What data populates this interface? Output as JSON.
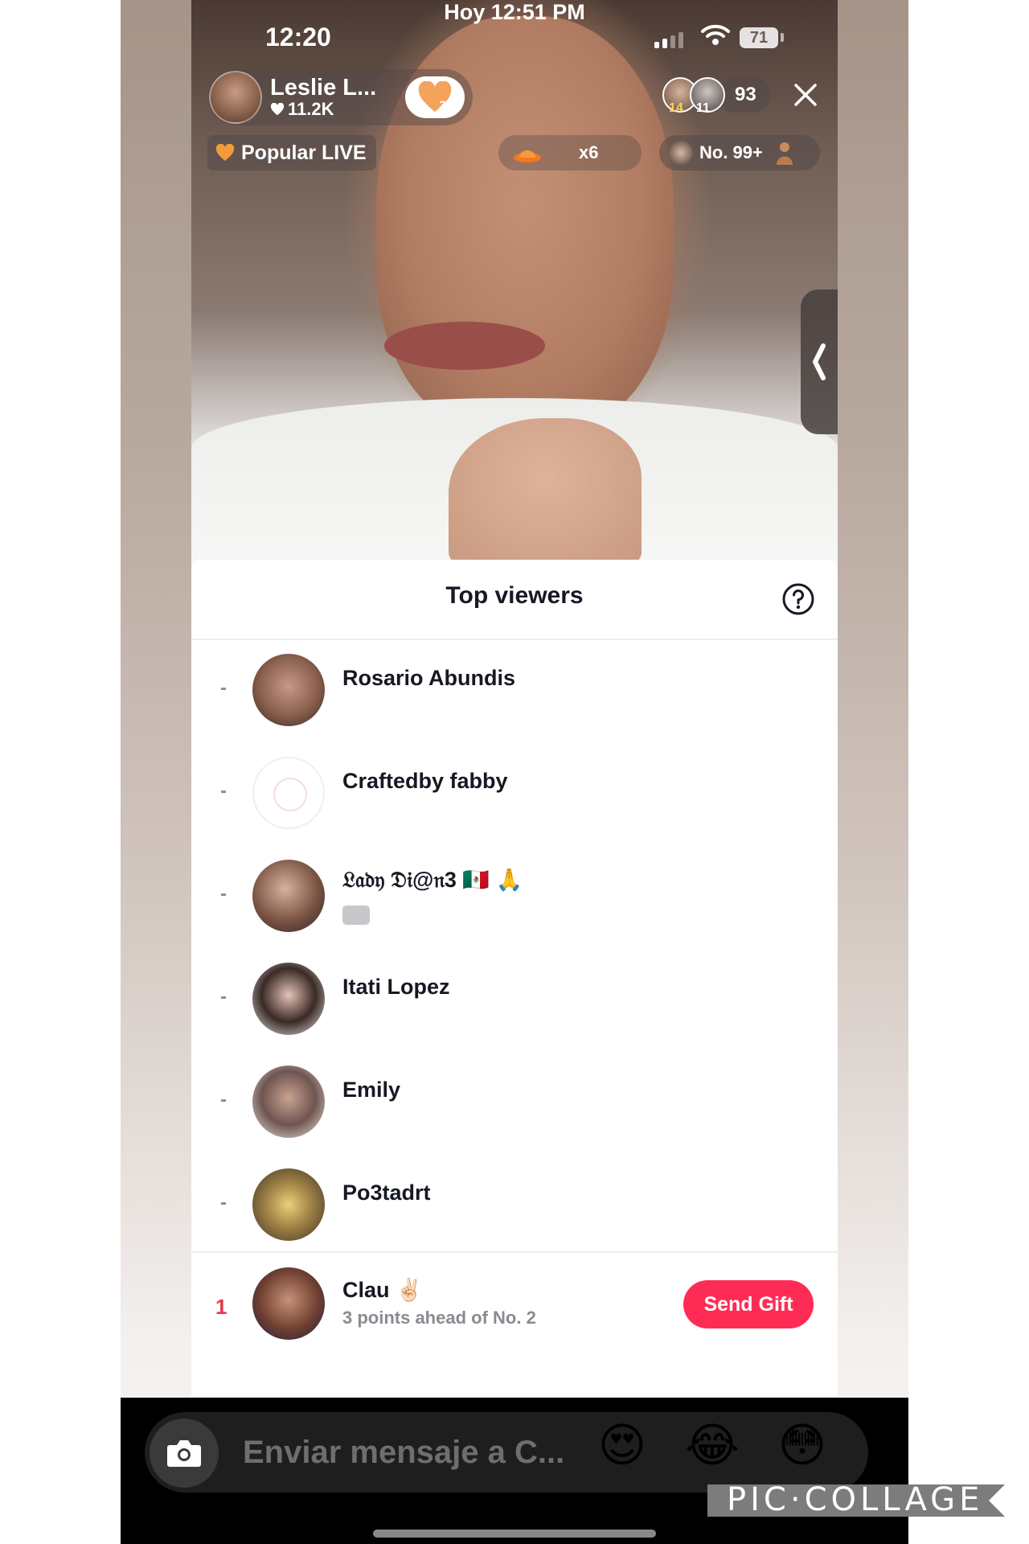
{
  "status_bar": {
    "capture_label": "Hoy 12:51 PM",
    "time": "12:20",
    "battery": "71"
  },
  "live": {
    "host_name": "Leslie L...",
    "host_likes": "11.2K",
    "follow_badge_count": "3",
    "viewer_avatars": [
      {
        "badge": "14"
      },
      {
        "badge": "11"
      }
    ],
    "viewer_count": "93",
    "popular_label": "Popular LIVE",
    "gift_multiplier": "x6",
    "rank_label": "No. 99+"
  },
  "sheet": {
    "title": "Top viewers",
    "viewers": [
      {
        "rank": "-",
        "name": "Rosario Abundis",
        "has_tag": false
      },
      {
        "rank": "-",
        "name": "Craftedby fabby",
        "has_tag": false
      },
      {
        "rank": "-",
        "name": "𝔏𝔞𝔡𝔶 𝔇𝔦@𝔫3 🇲🇽 🙏",
        "has_tag": true
      },
      {
        "rank": "-",
        "name": "Itati Lopez",
        "has_tag": false
      },
      {
        "rank": "-",
        "name": "Emily",
        "has_tag": false
      },
      {
        "rank": "-",
        "name": "Po3tadrt",
        "has_tag": false
      }
    ],
    "me": {
      "rank": "1",
      "name": "Clau ✌🏻",
      "subtitle": "3 points ahead of No. 2",
      "button": "Send Gift"
    }
  },
  "composer": {
    "placeholder": "Enviar mensaje a C...",
    "emojis": [
      "😍",
      "😂",
      "😳"
    ]
  },
  "watermark": "PIC·COLLAGE",
  "colors": {
    "accent": "#fe2c55",
    "rank_highlight": "#e8374f"
  }
}
